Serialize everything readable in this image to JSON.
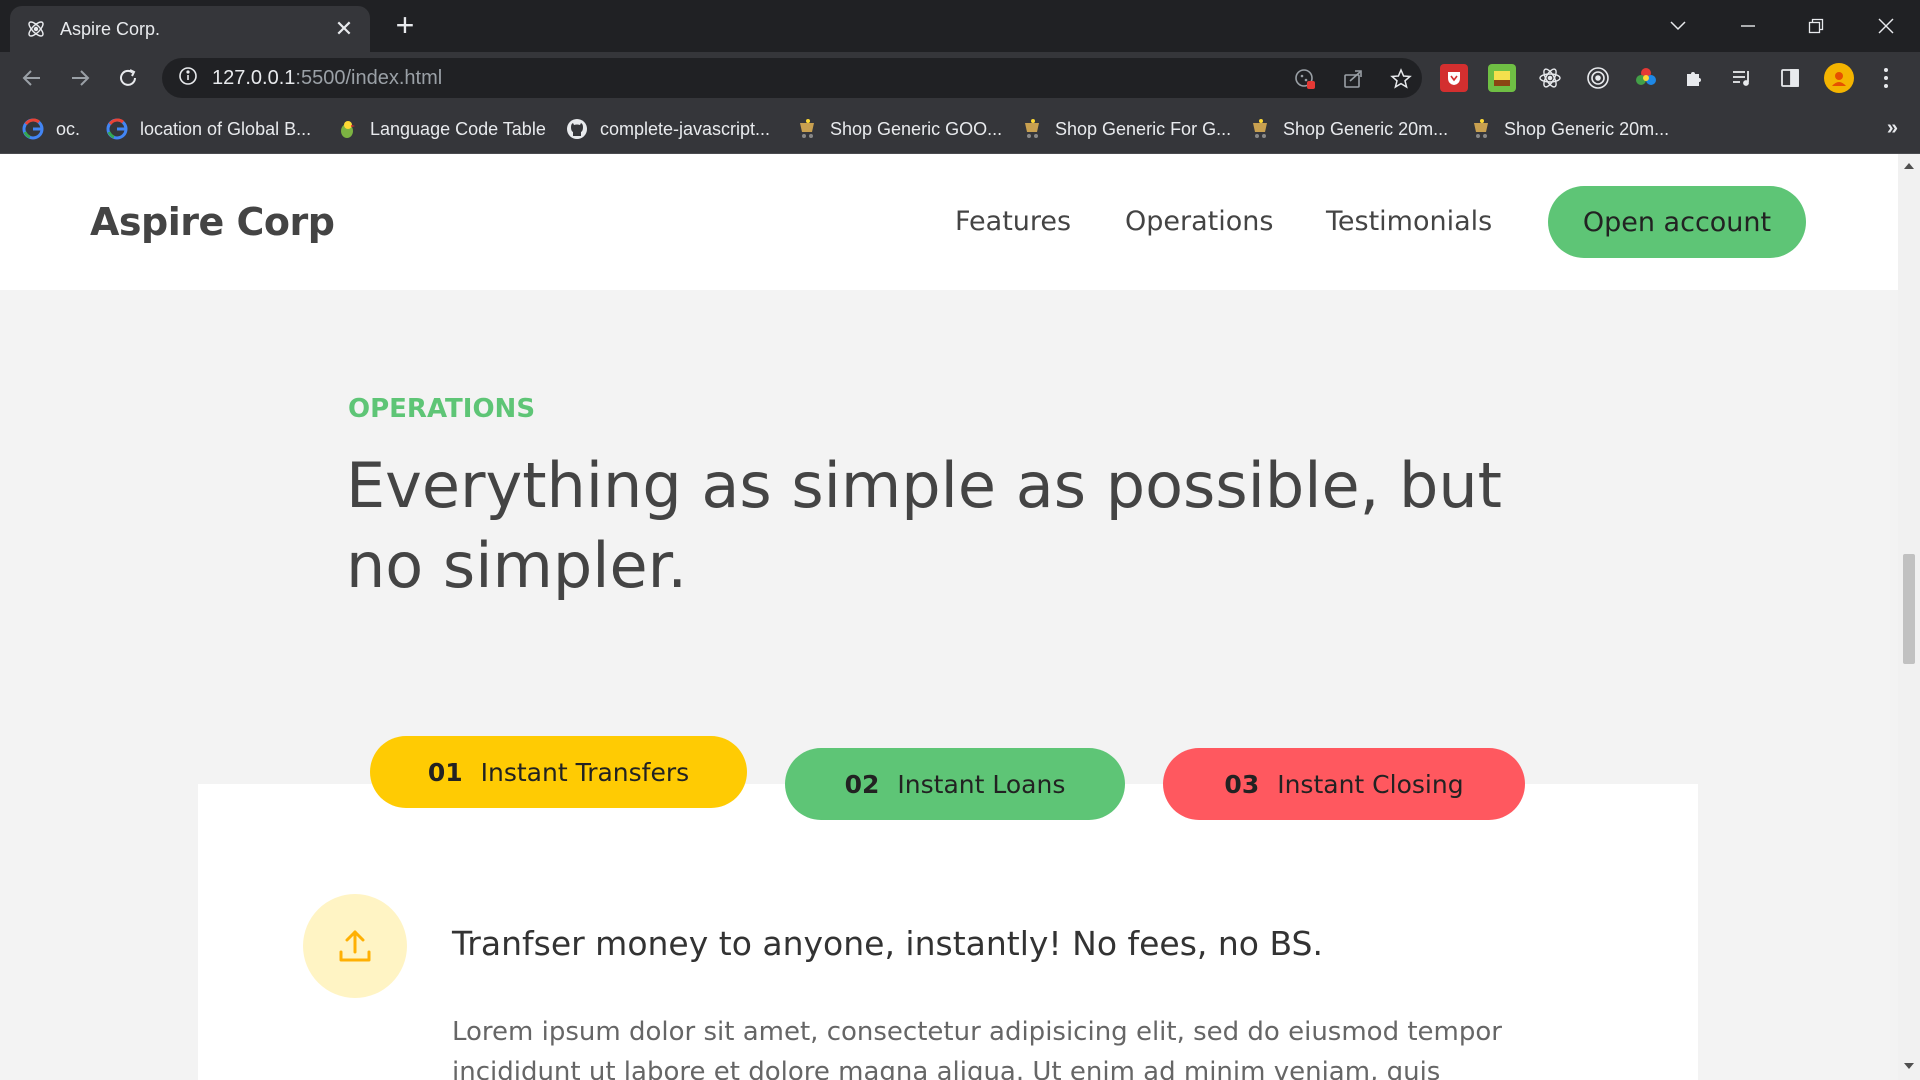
{
  "browser": {
    "tab_title": "Aspire Corp.",
    "tab_close": "✕",
    "new_tab": "+",
    "url_host": "127.0.0.1",
    "url_path": ":5500/index.html",
    "bookmarks": [
      {
        "label": "oc.",
        "icon": "google-icon"
      },
      {
        "label": "location of Global B...",
        "icon": "google-icon"
      },
      {
        "label": "Language Code Table",
        "icon": "parrot-icon"
      },
      {
        "label": "complete-javascript...",
        "icon": "github-icon"
      },
      {
        "label": "Shop Generic GOO...",
        "icon": "shop-icon"
      },
      {
        "label": "Shop Generic For G...",
        "icon": "shop-icon"
      },
      {
        "label": "Shop Generic 20m...",
        "icon": "shop-icon"
      },
      {
        "label": "Shop Generic 20m...",
        "icon": "shop-icon"
      }
    ],
    "bookmarks_more": "»"
  },
  "site": {
    "logo": "Aspire Corp",
    "nav": {
      "features": "Features",
      "operations": "Operations",
      "testimonials": "Testimonials",
      "cta": "Open account"
    }
  },
  "operations": {
    "label": "OPERATIONS",
    "heading": "Everything as simple as possible, but no simpler.",
    "tabs": [
      {
        "num": "01",
        "label": "Instant Transfers",
        "color": "#ffcb03",
        "active": true
      },
      {
        "num": "02",
        "label": "Instant Loans",
        "color": "#5ec576",
        "active": false
      },
      {
        "num": "03",
        "label": "Instant Closing",
        "color": "#ff585f",
        "active": false
      }
    ],
    "content": {
      "icon": "upload-icon",
      "title": "Tranfser money to anyone, instantly! No fees, no BS.",
      "body": "Lorem ipsum dolor sit amet, consectetur adipisicing elit, sed do eiusmod tempor incididunt ut labore et dolore magna aliqua. Ut enim ad minim veniam, quis nostrud"
    }
  },
  "colors": {
    "accent_green": "#5ec576",
    "accent_yellow": "#ffcb03",
    "accent_red": "#ff585f",
    "chrome_dark": "#202124",
    "chrome_toolbar": "#35363a"
  }
}
